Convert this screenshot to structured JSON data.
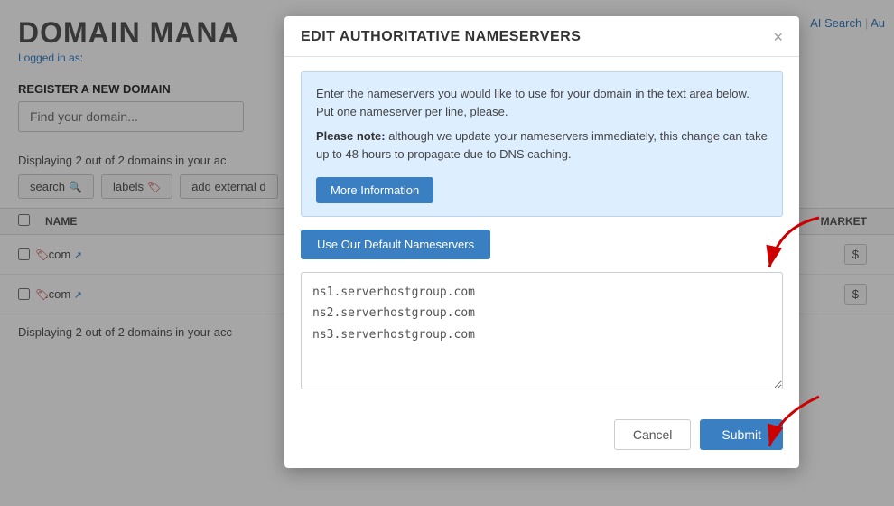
{
  "page": {
    "title": "DOMAIN MANA",
    "logged_in_label": "Logged in as:",
    "register_section": {
      "label": "REGISTER A NEW DOMAIN",
      "input_placeholder": "Find your domain..."
    },
    "displaying_text_top": "Displaying 2 out of 2 domains in your ac",
    "displaying_text_bottom": "Displaying 2 out of 2 domains in your acc",
    "buttons": [
      {
        "label": "search",
        "icon": "search-icon"
      },
      {
        "label": "labels",
        "icon": "label-icon"
      },
      {
        "label": "add external d",
        "icon": null
      }
    ],
    "table": {
      "headers": [
        "NAME",
        "MARKET"
      ],
      "rows": [
        {
          "domain": ".com",
          "external_link": true
        },
        {
          "domain": ".com",
          "external_link": true
        }
      ]
    },
    "nav_links": [
      "AI Search",
      "Au"
    ]
  },
  "modal": {
    "title": "EDIT AUTHORITATIVE NAMESERVERS",
    "close_label": "×",
    "info_box": {
      "line1": "Enter the nameservers you would like to use for your domain in the text area below. Put one nameserver per line, please.",
      "note_label": "Please note:",
      "line2": " although we update your nameservers immediately, this change can take up to 48 hours to propagate due to DNS caching."
    },
    "more_info_button": "More Information",
    "default_ns_button": "Use Our Default Nameservers",
    "nameservers_value": "ns1.serverhostgroup.com\nns2.serverhostgroup.com\nns3.serverhostgroup.com",
    "footer": {
      "cancel_label": "Cancel",
      "submit_label": "Submit"
    }
  }
}
